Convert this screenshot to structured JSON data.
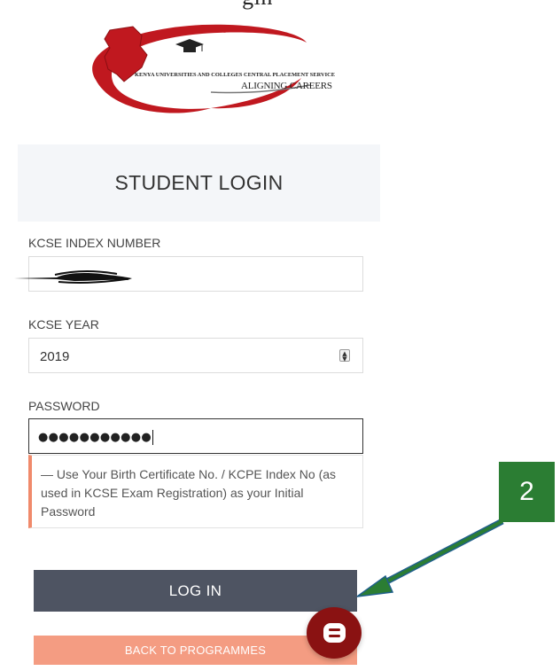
{
  "header": {
    "cropped_text": "'gin"
  },
  "logo": {
    "line1": "KENYA UNIVERSITIES AND COLLEGES CENTRAL PLACEMENT SERVICE",
    "line2": "ALIGNING CAREERS",
    "colors": {
      "swoosh": "#c0181f",
      "map": "#c0181f",
      "text": "#222222"
    }
  },
  "login": {
    "title": "STUDENT LOGIN"
  },
  "form": {
    "index_label": "KCSE INDEX NUMBER",
    "index_value": "",
    "year_label": "KCSE YEAR",
    "year_value": "2019",
    "password_label": "PASSWORD",
    "password_mask": "●●●●●●●●●●●",
    "hint": "— Use Your Birth Certificate No. / KCPE Index No (as used in KCSE Exam Registration) as your Initial Password"
  },
  "buttons": {
    "login_label": "LOG IN",
    "back_label": "BACK TO PROGRAMMES"
  },
  "annotation": {
    "badge_number": "2",
    "badge_color": "#2b7d33",
    "arrow_color": "#2b7d33"
  },
  "chat": {
    "icon": "chat-bubble-icon",
    "color": "#8a1212"
  },
  "colors": {
    "login_button": "#4e5462",
    "back_button": "#f49c82",
    "hint_accent": "#f08a6b",
    "card_bg": "#f4f6f9"
  }
}
